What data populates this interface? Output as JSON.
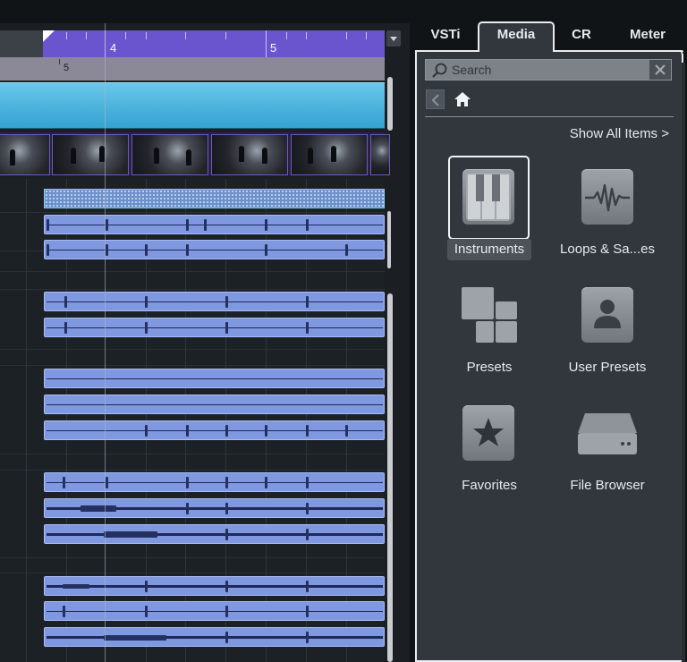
{
  "ruler": {
    "bar_labels": [
      "4",
      "5"
    ],
    "sub_label": "5"
  },
  "panel": {
    "tabs": [
      {
        "label": "VSTi",
        "active": false
      },
      {
        "label": "Media",
        "active": true
      },
      {
        "label": "CR",
        "active": false
      },
      {
        "label": "Meter",
        "active": false
      }
    ],
    "search_placeholder": "Search",
    "show_all": "Show All Items >",
    "items": [
      {
        "label": "Instruments",
        "icon": "piano-keys-icon",
        "selected": true
      },
      {
        "label": "Loops & Sa...es",
        "icon": "waveform-icon",
        "selected": false
      },
      {
        "label": "Presets",
        "icon": "preset-squares-icon",
        "selected": false
      },
      {
        "label": "User Presets",
        "icon": "user-icon",
        "selected": false
      },
      {
        "label": "Favorites",
        "icon": "star-icon",
        "selected": false
      },
      {
        "label": "File Browser",
        "icon": "drive-icon",
        "selected": false
      }
    ]
  },
  "colors": {
    "ruler_accent": "#6b55cf",
    "video_track": "#4bb4de",
    "audio_event": "#7f98e0",
    "panel_bg": "#32373d",
    "panel_border": "#e9ebee"
  }
}
